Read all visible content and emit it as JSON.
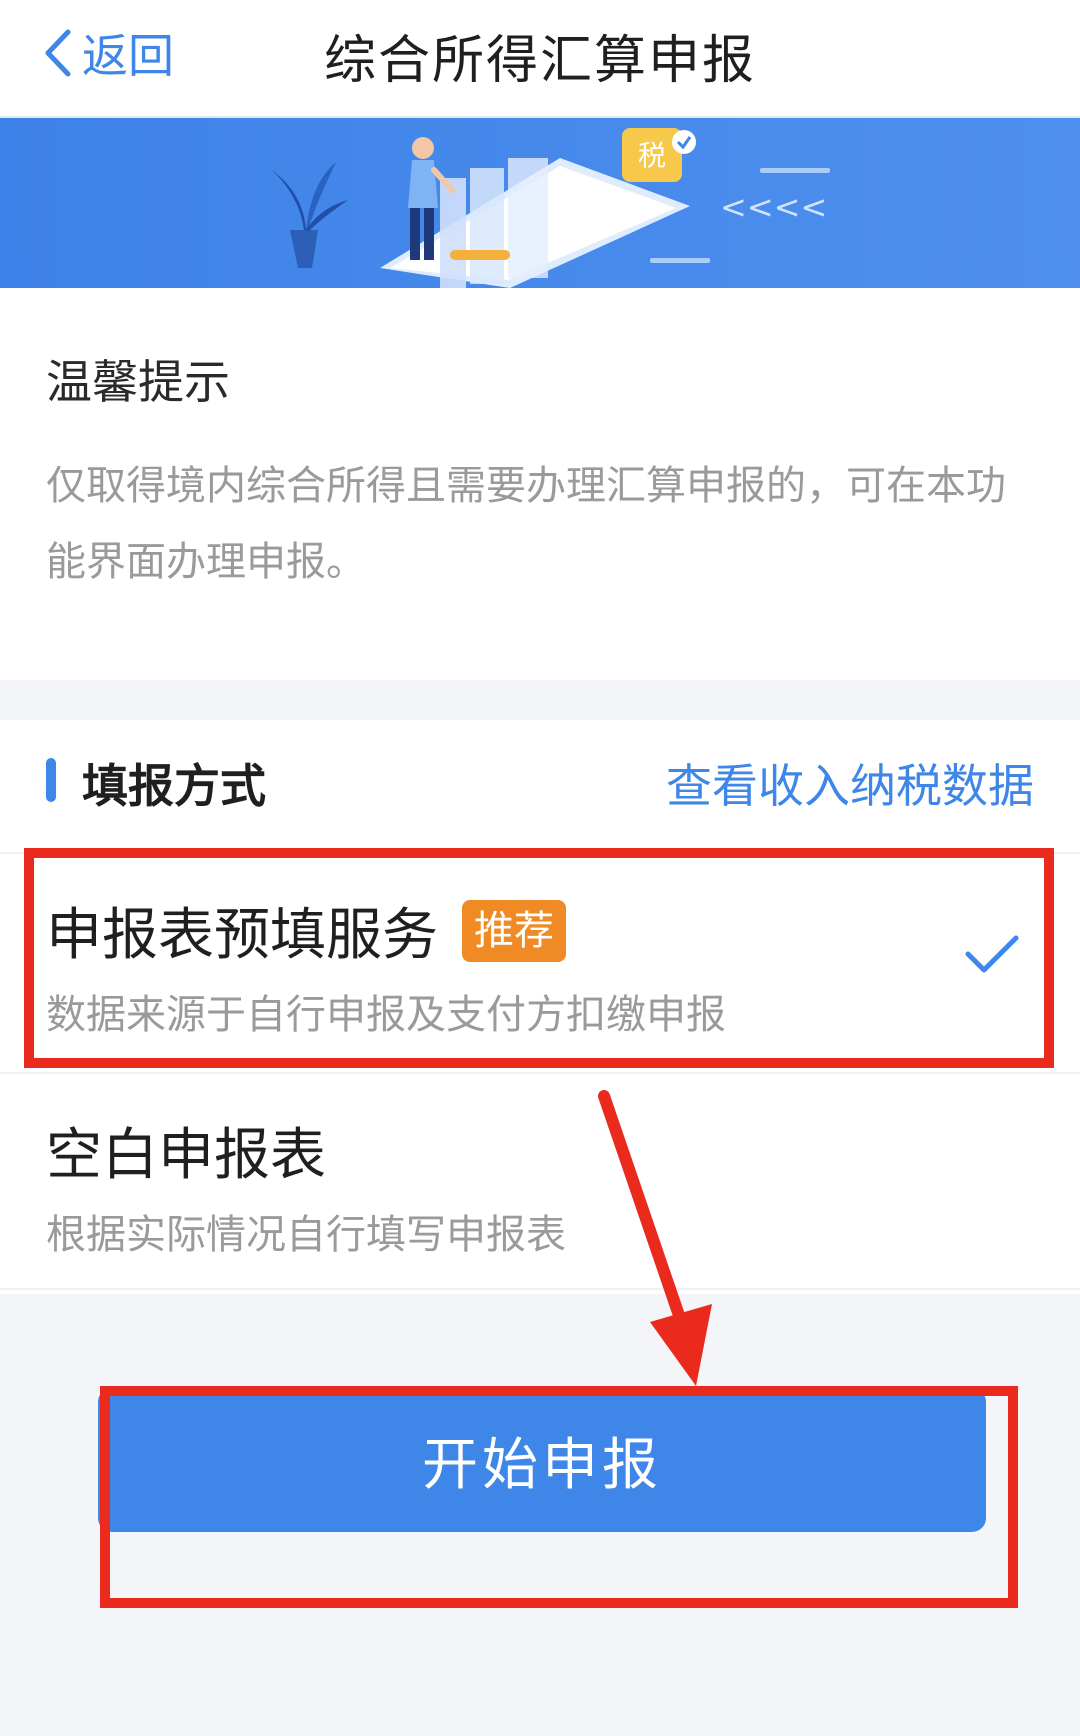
{
  "nav": {
    "back_label": "返回",
    "title": "综合所得汇算申报"
  },
  "banner": {
    "tax_badge": "税",
    "chevrons": "<<<<",
    "colors": {
      "bg": "#4a8bea",
      "dark": "#2f6fd4"
    }
  },
  "tips": {
    "title": "温馨提示",
    "body": "仅取得境内综合所得且需要办理汇算申报的，可在本功能界面办理申报。"
  },
  "method": {
    "title": "填报方式",
    "link": "查看收入纳税数据",
    "options": [
      {
        "title": "申报表预填服务",
        "badge": "推荐",
        "desc": "数据来源于自行申报及支付方扣缴申报",
        "selected": true
      },
      {
        "title": "空白申报表",
        "badge": "",
        "desc": "根据实际情况自行填写申报表",
        "selected": false
      }
    ]
  },
  "start_button": "开始申报",
  "colors": {
    "accent": "#3e86e8",
    "badge": "#f08a24",
    "annotation": "#ea2a1d"
  }
}
